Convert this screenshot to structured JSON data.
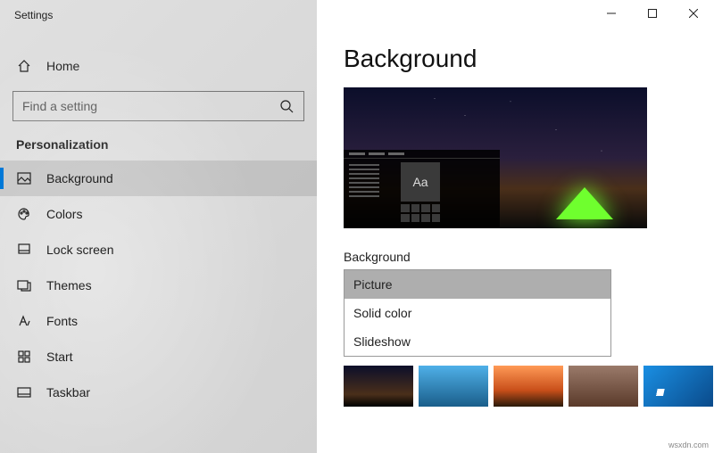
{
  "window": {
    "title": "Settings"
  },
  "sidebar": {
    "home": "Home",
    "search_placeholder": "Find a setting",
    "section": "Personalization",
    "items": [
      {
        "label": "Background"
      },
      {
        "label": "Colors"
      },
      {
        "label": "Lock screen"
      },
      {
        "label": "Themes"
      },
      {
        "label": "Fonts"
      },
      {
        "label": "Start"
      },
      {
        "label": "Taskbar"
      }
    ]
  },
  "main": {
    "title": "Background",
    "preview_sample": "Aa",
    "dropdown_label": "Background",
    "dropdown_options": [
      {
        "label": "Picture"
      },
      {
        "label": "Solid color"
      },
      {
        "label": "Slideshow"
      }
    ]
  },
  "watermark": "wsxdn.com"
}
